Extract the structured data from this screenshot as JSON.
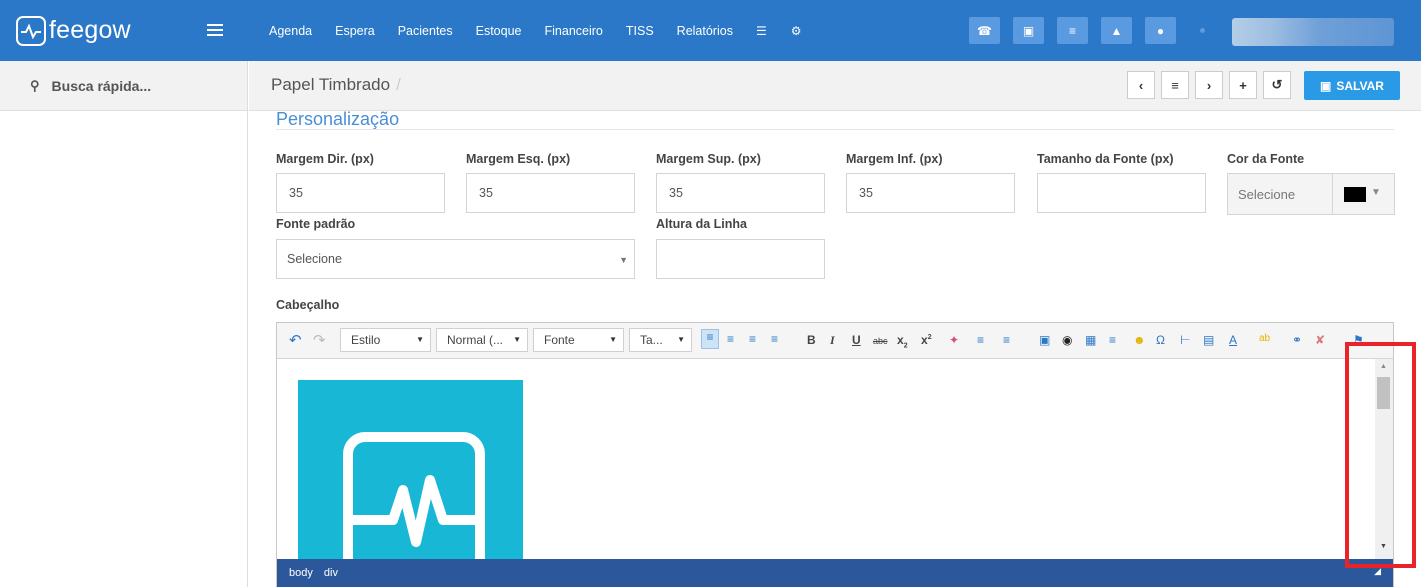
{
  "brand": {
    "name": "feegow"
  },
  "nav": {
    "items": [
      "Agenda",
      "Espera",
      "Pacientes",
      "Estoque",
      "Financeiro",
      "TISS",
      "Relatórios"
    ]
  },
  "sidebar": {
    "search_label": "Busca rápida..."
  },
  "breadcrumb": {
    "title": "Papel Timbrado",
    "separator": "/"
  },
  "toolbar": {
    "save_label": "SALVAR"
  },
  "section": {
    "title": "Personalização"
  },
  "form": {
    "margem_dir": {
      "label": "Margem Dir. (px)",
      "value": "35"
    },
    "margem_esq": {
      "label": "Margem Esq. (px)",
      "value": "35"
    },
    "margem_sup": {
      "label": "Margem Sup. (px)",
      "value": "35"
    },
    "margem_inf": {
      "label": "Margem Inf. (px)",
      "value": "35"
    },
    "tamanho_fonte": {
      "label": "Tamanho da Fonte (px)",
      "value": ""
    },
    "cor_fonte": {
      "label": "Cor da Fonte",
      "value": "Selecione",
      "swatch": "#000000"
    },
    "fonte_padrao": {
      "label": "Fonte padrão",
      "value": "Selecione"
    },
    "altura_linha": {
      "label": "Altura da Linha",
      "value": ""
    },
    "cabecalho": {
      "label": "Cabeçalho"
    }
  },
  "editor": {
    "combos": {
      "style": "Estilo",
      "format": "Normal (...",
      "font": "Fonte",
      "size": "Ta..."
    },
    "path": [
      "body",
      "div"
    ]
  },
  "colors": {
    "topbar": "#2a78c7",
    "accent": "#2a9ae6",
    "logo_bg": "#19b7d6",
    "highlight": "#e8232a",
    "pathbar": "#2c579a"
  }
}
